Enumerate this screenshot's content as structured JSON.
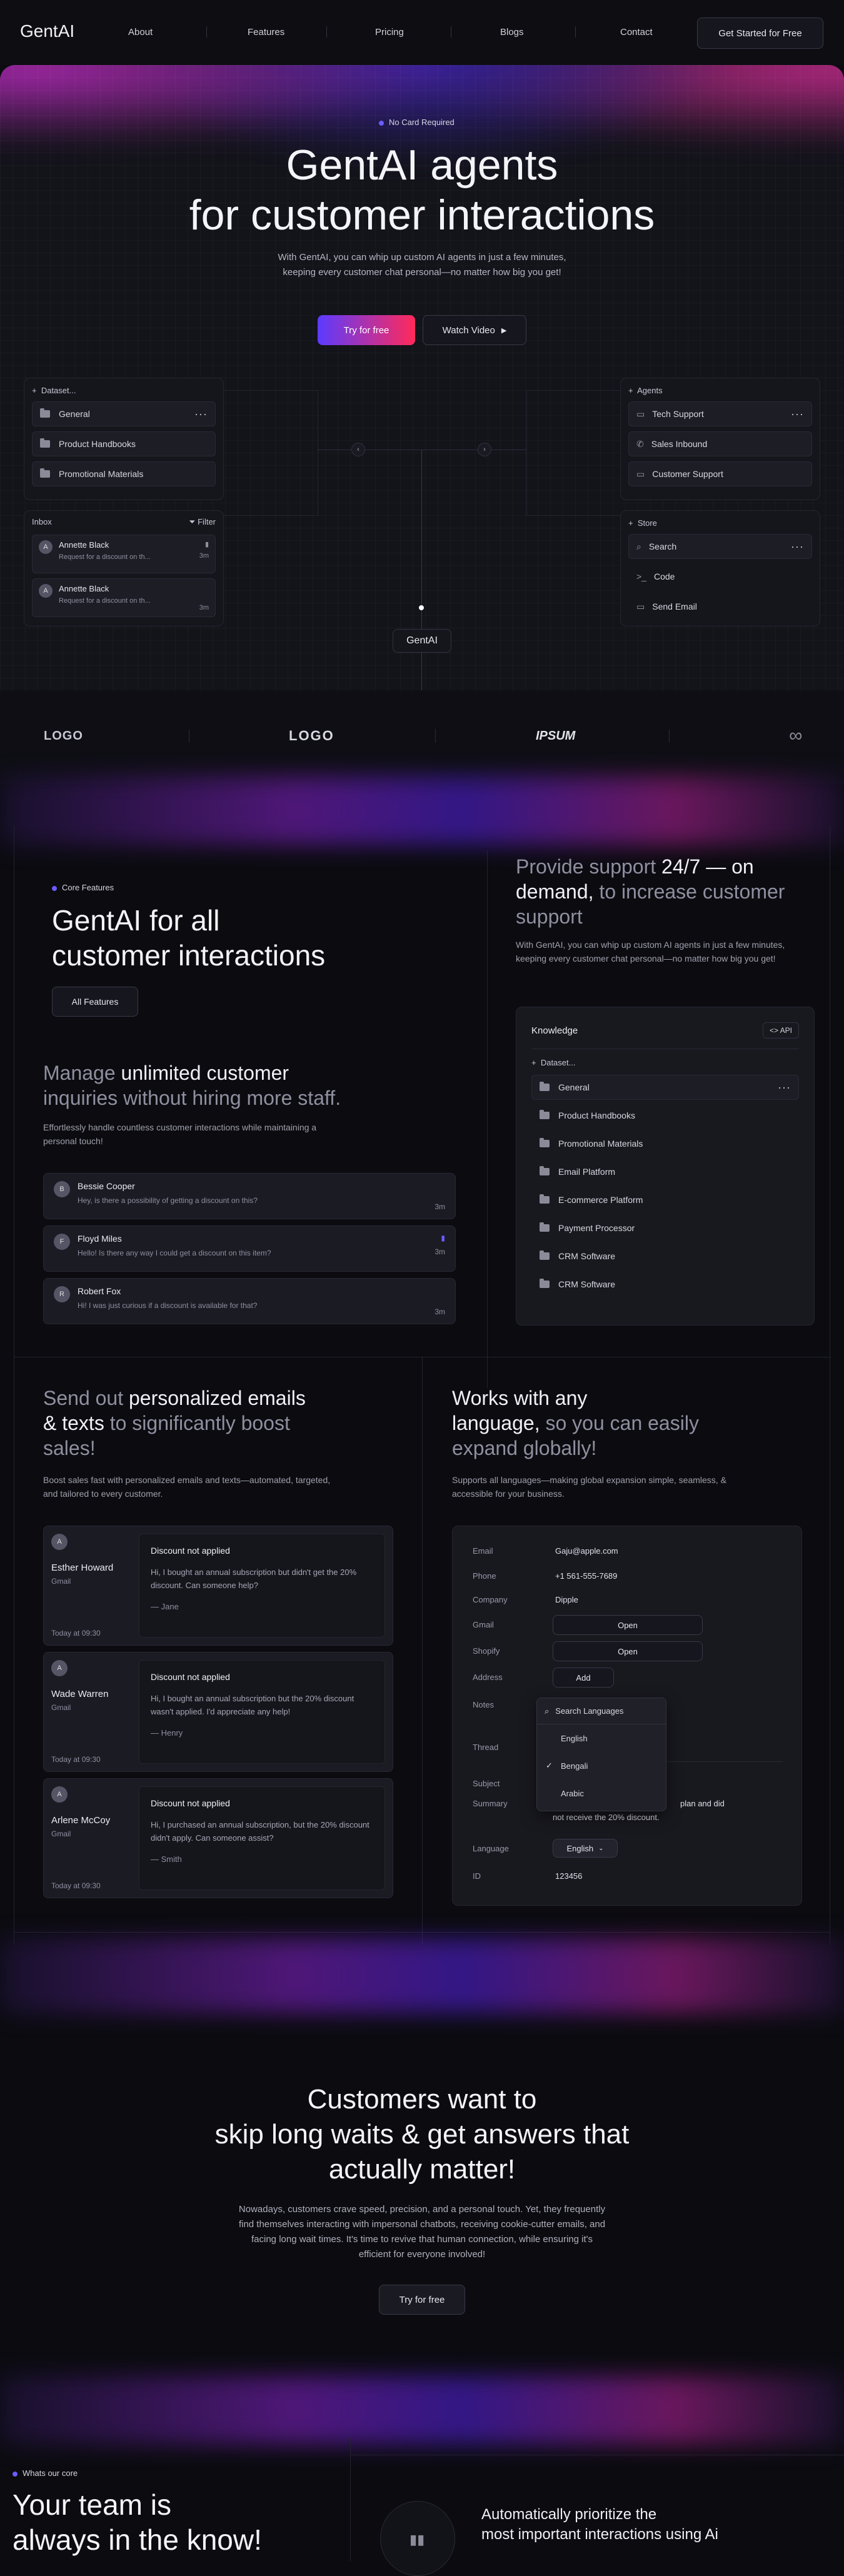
{
  "nav": {
    "logo": "GentAI",
    "links": [
      "About",
      "Features",
      "Pricing",
      "Blogs",
      "Contact"
    ],
    "cta": "Get Started for Free"
  },
  "hero": {
    "badge": "No Card Required",
    "title_line1": "GentAI agents",
    "title_line2": "for customer interactions",
    "subtitle": "With GentAI, you can whip up custom AI agents in just a few minutes, keeping every customer chat personal—no matter how big you get!",
    "primary_cta": "Try for free",
    "secondary_cta": "Watch Video",
    "dataset": {
      "header": "Dataset...",
      "items": [
        "General",
        "Product Handbooks",
        "Promotional Materials"
      ]
    },
    "inbox": {
      "title": "Inbox",
      "filter": "Filter",
      "messages": [
        {
          "initial": "A",
          "name": "Annette Black",
          "preview": "Request for a discount on th...",
          "time": "3m"
        },
        {
          "initial": "A",
          "name": "Annette Black",
          "preview": "Request for a discount on th...",
          "time": "3m"
        }
      ]
    },
    "agents": {
      "header": "Agents",
      "items": [
        "Tech Support",
        "Sales Inbound",
        "Customer Support"
      ]
    },
    "store": {
      "header": "Store",
      "items": [
        "Search",
        "Code",
        "Send Email"
      ]
    },
    "center_label": "GentAI"
  },
  "logos": [
    "LOGO",
    "LOGO",
    "IPSUM",
    "∞"
  ],
  "core": {
    "badge": "Core Features",
    "title_line1": "GentAI for all",
    "title_line2": "customer interactions",
    "all_features": "All Features",
    "manage_title_a": "Manage ",
    "manage_title_b": "unlimited customer",
    "manage_title_c": "inquiries without hiring more staff.",
    "manage_desc": "Effortlessly handle countless customer interactions while maintaining a personal touch!",
    "chats": [
      {
        "initial": "B",
        "name": "Bessie Cooper",
        "msg": "Hey, is there a possibility of getting a discount on this?",
        "time": "3m"
      },
      {
        "initial": "F",
        "name": "Floyd Miles",
        "msg": "Hello! Is there any way I could get a discount on this item?",
        "time": "3m"
      },
      {
        "initial": "R",
        "name": "Robert Fox",
        "msg": "Hi! I was just curious if a discount is available for that?",
        "time": "3m"
      }
    ],
    "support_a": "Provide support ",
    "support_b": "24/7 — on demand,",
    "support_c": " to increase customer support",
    "support_desc": "With GentAI, you can whip up custom AI agents in just a few minutes, keeping every customer chat personal—no matter how big you get!",
    "knowledge": {
      "title": "Knowledge",
      "api": "API",
      "dataset": "Dataset...",
      "items": [
        "General",
        "Product Handbooks",
        "Promotional Materials",
        "Email Platform",
        "E-commerce Platform",
        "Payment Processor",
        "CRM Software",
        "CRM Software"
      ]
    }
  },
  "emails": {
    "title_a": "Send out ",
    "title_b": "personalized  emails",
    "title_c": "& texts",
    "title_d": " to significantly boost sales!",
    "desc": "Boost sales fast with personalized emails and texts—automated, targeted, and tailored to every customer.",
    "cards": [
      {
        "initial": "A",
        "name": "Esther Howard",
        "channel": "Gmail",
        "time": "Today at 09:30",
        "subject": "Discount not applied",
        "body": "Hi, I bought an annual subscription but didn't get the 20% discount. Can someone help?",
        "sign": "Jane"
      },
      {
        "initial": "A",
        "name": "Wade Warren",
        "channel": "Gmail",
        "time": "Today at 09:30",
        "subject": "Discount not applied",
        "body": "Hi, I bought an annual subscription but the 20% discount wasn't applied. I'd appreciate any help!",
        "sign": "Henry"
      },
      {
        "initial": "A",
        "name": "Arlene McCoy",
        "channel": "Gmail",
        "time": "Today at 09:30",
        "subject": "Discount not applied",
        "body": "Hi, I purchased an annual subscription, but the 20% discount didn't apply. Can someone assist?",
        "sign": "Smith"
      }
    ]
  },
  "language": {
    "title_a": "Works with any",
    "title_b": "language,",
    "title_c": " so you can easily expand globally!",
    "desc": "Supports all languages—making global expansion simple, seamless, & accessible for your business.",
    "fields": {
      "email_label": "Email",
      "email_value": "Gaju@apple.com",
      "phone_label": "Phone",
      "phone_value": "+1 561-555-7689",
      "company_label": "Company",
      "company_value": "Dipple",
      "gmail_label": "Gmail",
      "gmail_value": "Open",
      "shopify_label": "Shopify",
      "shopify_value": "Open",
      "address_label": "Address",
      "address_value": "Add",
      "notes_label": "Notes",
      "thread_label": "Thread",
      "subject_label": "Subject",
      "summary_label": "Summary",
      "summary_value_a": "plan and did",
      "summary_value_b": "not receive the 20% discount.",
      "language_label": "Language",
      "language_value": "English",
      "id_label": "ID",
      "id_value": "123456"
    },
    "dropdown": {
      "search": "Search Languages",
      "options": [
        "English",
        "Bengali",
        "Arabic"
      ],
      "selected": "Bengali"
    }
  },
  "waits": {
    "title_line1": "Customers want to",
    "title_line2": "skip long waits & get answers that",
    "title_line3": "actually matter!",
    "desc": "Nowadays, customers crave speed, precision, and a personal touch. Yet, they frequently find themselves interacting with impersonal chatbots, receiving cookie-cutter emails, and facing long wait times. It's time to revive that human connection, while ensuring it's efficient for everyone involved!",
    "cta": "Try for free"
  },
  "core2": {
    "badge": "Whats our core",
    "title_line1": "Your team is",
    "title_line2": "always in the know!",
    "prio_title_line1": "Automatically prioritize the",
    "prio_title_line2": "most important interactions using Ai"
  }
}
